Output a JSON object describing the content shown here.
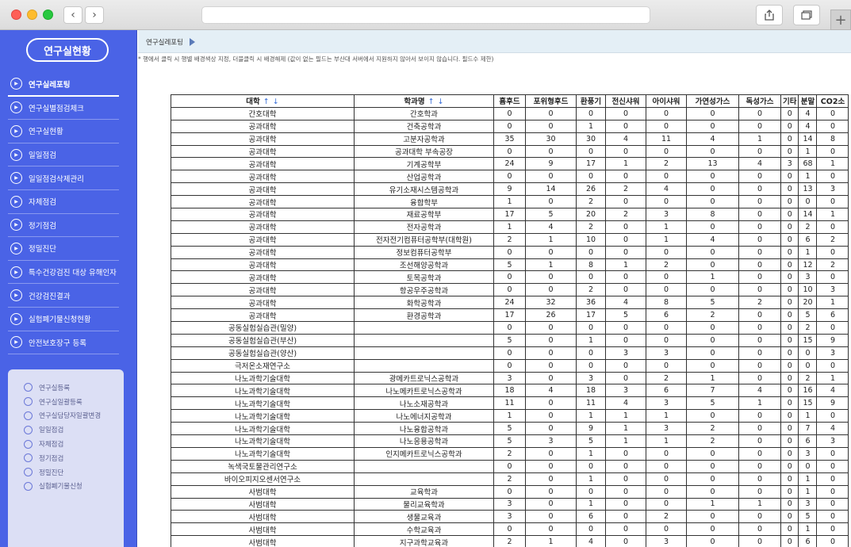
{
  "sidebar": {
    "title": "연구실현황",
    "menu": [
      "연구실레포팅",
      "연구실별점검체크",
      "연구실현황",
      "일일점검",
      "일일점검삭제관리",
      "자체점검",
      "정기점검",
      "정밀진단",
      "특수건강검진 대상 유해인자",
      "건강검진결과",
      "실험폐기물신청현황",
      "안전보호장구 등록"
    ],
    "submenu": [
      "연구실등록",
      "연구실일괄등록",
      "연구실담당자일괄변경",
      "일일점검",
      "자체점검",
      "정기점검",
      "정밀진단",
      "실험폐기물신청"
    ]
  },
  "breadcrumb": "연구실레포팅",
  "notice": "* 행에서 클릭 시 행별 배경색상 지정, 더블클릭 시 배경해제 (값이 없는 필드는 부산대 서버에서 지원하지 않아서 보이지 않습니다. 필드수 제한)",
  "table": {
    "headers": [
      "대학",
      "학과명",
      "흄후드",
      "포위형후드",
      "환풍기",
      "전신샤워",
      "아이샤워",
      "가연성가스",
      "독성가스",
      "기타",
      "분말",
      "CO2소"
    ],
    "sort_up": "↑",
    "sort_down": "↓",
    "rows": [
      [
        "간호대학",
        "간호학과",
        "0",
        "0",
        "0",
        "0",
        "0",
        "0",
        "0",
        "0",
        "4",
        "0"
      ],
      [
        "공과대학",
        "건축공학과",
        "0",
        "0",
        "1",
        "0",
        "0",
        "0",
        "0",
        "0",
        "4",
        "0"
      ],
      [
        "공과대학",
        "고분자공학과",
        "35",
        "30",
        "30",
        "4",
        "11",
        "4",
        "1",
        "0",
        "14",
        "8"
      ],
      [
        "공과대학",
        "공과대학 부속공장",
        "0",
        "0",
        "0",
        "0",
        "0",
        "0",
        "0",
        "0",
        "1",
        "0"
      ],
      [
        "공과대학",
        "기계공학부",
        "24",
        "9",
        "17",
        "1",
        "2",
        "13",
        "4",
        "3",
        "68",
        "1"
      ],
      [
        "공과대학",
        "산업공학과",
        "0",
        "0",
        "0",
        "0",
        "0",
        "0",
        "0",
        "0",
        "1",
        "0"
      ],
      [
        "공과대학",
        "유기소재시스템공학과",
        "9",
        "14",
        "26",
        "2",
        "4",
        "0",
        "0",
        "0",
        "13",
        "3"
      ],
      [
        "공과대학",
        "융합학부",
        "1",
        "0",
        "2",
        "0",
        "0",
        "0",
        "0",
        "0",
        "0",
        "0"
      ],
      [
        "공과대학",
        "재료공학부",
        "17",
        "5",
        "20",
        "2",
        "3",
        "8",
        "0",
        "0",
        "14",
        "1"
      ],
      [
        "공과대학",
        "전자공학과",
        "1",
        "4",
        "2",
        "0",
        "1",
        "0",
        "0",
        "0",
        "2",
        "0"
      ],
      [
        "공과대학",
        "전자전기컴퓨터공학부(대학원)",
        "2",
        "1",
        "10",
        "0",
        "1",
        "4",
        "0",
        "0",
        "6",
        "2"
      ],
      [
        "공과대학",
        "정보컴퓨터공학부",
        "0",
        "0",
        "0",
        "0",
        "0",
        "0",
        "0",
        "0",
        "1",
        "0"
      ],
      [
        "공과대학",
        "조선해양공학과",
        "5",
        "1",
        "8",
        "1",
        "2",
        "0",
        "0",
        "0",
        "12",
        "2"
      ],
      [
        "공과대학",
        "토목공학과",
        "0",
        "0",
        "0",
        "0",
        "0",
        "1",
        "0",
        "0",
        "3",
        "0"
      ],
      [
        "공과대학",
        "항공우주공학과",
        "0",
        "0",
        "2",
        "0",
        "0",
        "0",
        "0",
        "0",
        "10",
        "3"
      ],
      [
        "공과대학",
        "화학공학과",
        "24",
        "32",
        "36",
        "4",
        "8",
        "5",
        "2",
        "0",
        "20",
        "1"
      ],
      [
        "공과대학",
        "환경공학과",
        "17",
        "26",
        "17",
        "5",
        "6",
        "2",
        "0",
        "0",
        "5",
        "6"
      ],
      [
        "공동실험실습관(밀양)",
        "",
        "0",
        "0",
        "0",
        "0",
        "0",
        "0",
        "0",
        "0",
        "2",
        "0"
      ],
      [
        "공동실험실습관(부산)",
        "",
        "5",
        "0",
        "1",
        "0",
        "0",
        "0",
        "0",
        "0",
        "15",
        "9"
      ],
      [
        "공동실험실습관(양산)",
        "",
        "0",
        "0",
        "0",
        "3",
        "3",
        "0",
        "0",
        "0",
        "0",
        "3"
      ],
      [
        "극저온소재연구소",
        "",
        "0",
        "0",
        "0",
        "0",
        "0",
        "0",
        "0",
        "0",
        "0",
        "0"
      ],
      [
        "나노과학기술대학",
        "광메카트로닉스공학과",
        "3",
        "0",
        "3",
        "0",
        "2",
        "1",
        "0",
        "0",
        "2",
        "1"
      ],
      [
        "나노과학기술대학",
        "나노메카트로닉스공학과",
        "18",
        "4",
        "18",
        "3",
        "6",
        "7",
        "4",
        "0",
        "16",
        "4"
      ],
      [
        "나노과학기술대학",
        "나노소재공학과",
        "11",
        "0",
        "11",
        "4",
        "3",
        "5",
        "1",
        "0",
        "15",
        "9"
      ],
      [
        "나노과학기술대학",
        "나노에너지공학과",
        "1",
        "0",
        "1",
        "1",
        "1",
        "0",
        "0",
        "0",
        "1",
        "0"
      ],
      [
        "나노과학기술대학",
        "나노융합공학과",
        "5",
        "0",
        "9",
        "1",
        "3",
        "2",
        "0",
        "0",
        "7",
        "4"
      ],
      [
        "나노과학기술대학",
        "나노응용공학과",
        "5",
        "3",
        "5",
        "1",
        "1",
        "2",
        "0",
        "0",
        "6",
        "3"
      ],
      [
        "나노과학기술대학",
        "인지메카트로닉스공학과",
        "2",
        "0",
        "1",
        "0",
        "0",
        "0",
        "0",
        "0",
        "3",
        "0"
      ],
      [
        "녹색국토물관리연구소",
        "",
        "0",
        "0",
        "0",
        "0",
        "0",
        "0",
        "0",
        "0",
        "0",
        "0"
      ],
      [
        "바이오피지오센서연구소",
        "",
        "2",
        "0",
        "1",
        "0",
        "0",
        "0",
        "0",
        "0",
        "1",
        "0"
      ],
      [
        "사범대학",
        "교육학과",
        "0",
        "0",
        "0",
        "0",
        "0",
        "0",
        "0",
        "0",
        "1",
        "0"
      ],
      [
        "사범대학",
        "물리교육학과",
        "3",
        "0",
        "1",
        "0",
        "0",
        "1",
        "1",
        "0",
        "3",
        "0"
      ],
      [
        "사범대학",
        "생물교육과",
        "3",
        "0",
        "6",
        "0",
        "2",
        "0",
        "0",
        "0",
        "5",
        "0"
      ],
      [
        "사범대학",
        "수학교육과",
        "0",
        "0",
        "0",
        "0",
        "0",
        "0",
        "0",
        "0",
        "1",
        "0"
      ],
      [
        "사범대학",
        "지구과학교육과",
        "2",
        "1",
        "4",
        "0",
        "3",
        "0",
        "0",
        "0",
        "6",
        "0"
      ]
    ]
  }
}
